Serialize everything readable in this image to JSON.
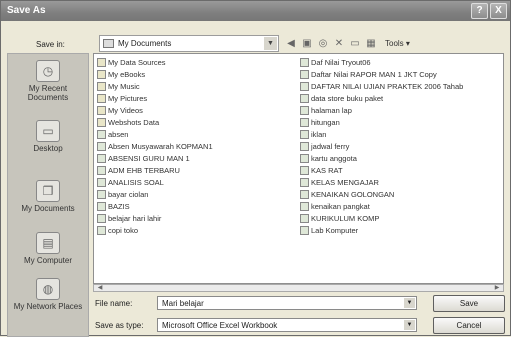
{
  "window": {
    "title": "Save As",
    "help": "?",
    "close": "X"
  },
  "toolbar": {
    "save_in_label": "Save in:",
    "save_in_value": "My Documents",
    "tools_label": "Tools ▾"
  },
  "places": [
    {
      "label": "My Recent Documents",
      "icon": "clock-icon"
    },
    {
      "label": "Desktop",
      "icon": "desktop-icon"
    },
    {
      "label": "My Documents",
      "icon": "folder-icon"
    },
    {
      "label": "My Computer",
      "icon": "computer-icon"
    },
    {
      "label": "My Network Places",
      "icon": "network-icon"
    }
  ],
  "files_col1": [
    {
      "name": "My Data Sources",
      "type": "folder"
    },
    {
      "name": "My eBooks",
      "type": "folder"
    },
    {
      "name": "My Music",
      "type": "folder"
    },
    {
      "name": "My Pictures",
      "type": "folder"
    },
    {
      "name": "My Videos",
      "type": "folder"
    },
    {
      "name": "Webshots Data",
      "type": "folder"
    },
    {
      "name": "absen",
      "type": "xls"
    },
    {
      "name": "Absen Musyawarah KOPMAN1",
      "type": "xls"
    },
    {
      "name": "ABSENSI GURU MAN 1",
      "type": "xls"
    },
    {
      "name": "ADM EHB TERBARU",
      "type": "xls"
    },
    {
      "name": "ANALISIS SOAL",
      "type": "xls"
    },
    {
      "name": "bayar ciolan",
      "type": "xls"
    },
    {
      "name": "BAZIS",
      "type": "xls"
    },
    {
      "name": "belajar hari lahir",
      "type": "xls"
    },
    {
      "name": "copi toko",
      "type": "xls"
    }
  ],
  "files_col2": [
    {
      "name": "Daf Nilai Tryout06",
      "type": "xls"
    },
    {
      "name": "Daftar Nilai RAPOR MAN 1 JKT Copy",
      "type": "xls"
    },
    {
      "name": "DAFTAR NILAI UJIAN PRAKTEK 2006 Tahab",
      "type": "xls"
    },
    {
      "name": "data store buku paket",
      "type": "xls"
    },
    {
      "name": "halaman lap",
      "type": "xls"
    },
    {
      "name": "hitungan",
      "type": "xls"
    },
    {
      "name": "iklan",
      "type": "xls"
    },
    {
      "name": "jadwal ferry",
      "type": "xls"
    },
    {
      "name": "kartu anggota",
      "type": "xls"
    },
    {
      "name": "KAS RAT",
      "type": "xls"
    },
    {
      "name": "KELAS MENGAJAR",
      "type": "xls"
    },
    {
      "name": "KENAIKAN GOLONGAN",
      "type": "xls"
    },
    {
      "name": "kenaikan pangkat",
      "type": "xls"
    },
    {
      "name": "KURIKULUM KOMP",
      "type": "xls"
    },
    {
      "name": "Lab Komputer",
      "type": "xls"
    }
  ],
  "form": {
    "file_name_label": "File name:",
    "file_name_value": "Mari belajar",
    "save_type_label": "Save as type:",
    "save_type_value": "Microsoft Office Excel Workbook",
    "save_button": "Save",
    "cancel_button": "Cancel"
  }
}
